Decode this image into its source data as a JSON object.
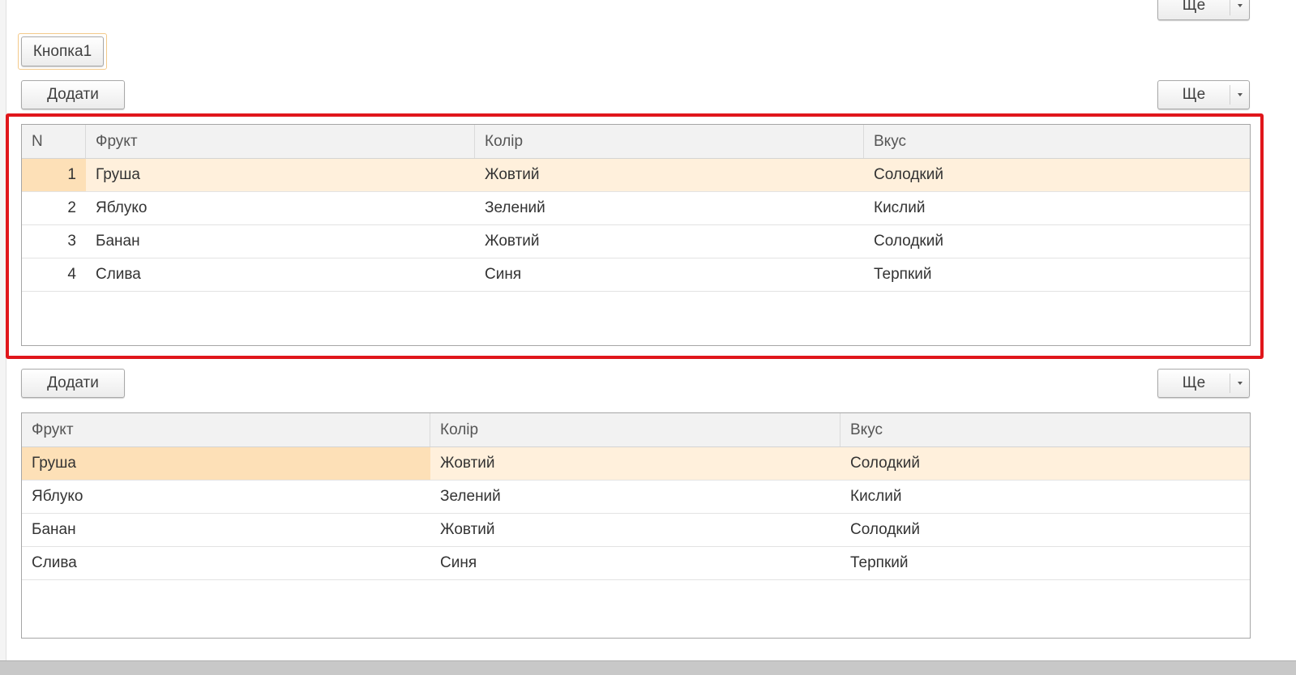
{
  "toolbar_top": {
    "more_label": "Ще"
  },
  "button1": {
    "label": "Кнопка1"
  },
  "table1": {
    "add_label": "Додати",
    "more_label": "Ще",
    "columns": [
      "N",
      "Фрукт",
      "Колір",
      "Вкус"
    ],
    "rows": [
      [
        "1",
        "Груша",
        "Жовтий",
        "Солодкий"
      ],
      [
        "2",
        "Яблуко",
        "Зелений",
        "Кислий"
      ],
      [
        "3",
        "Банан",
        "Жовтий",
        "Солодкий"
      ],
      [
        "4",
        "Слива",
        "Синя",
        "Терпкий"
      ]
    ],
    "selected_row": 0
  },
  "table2": {
    "add_label": "Додати",
    "more_label": "Ще",
    "columns": [
      "Фрукт",
      "Колір",
      "Вкус"
    ],
    "rows": [
      [
        "Груша",
        "Жовтий",
        "Солодкий"
      ],
      [
        "Яблуко",
        "Зелений",
        "Кислий"
      ],
      [
        "Банан",
        "Жовтий",
        "Солодкий"
      ],
      [
        "Слива",
        "Синя",
        "Терпкий"
      ]
    ],
    "selected_row": 0
  },
  "colors": {
    "selection_row": "#fff0dc",
    "selection_cell": "#fde0b7",
    "highlight_frame": "#e0161b"
  },
  "icons": {
    "more_dropdown": "chevron-down-icon"
  }
}
